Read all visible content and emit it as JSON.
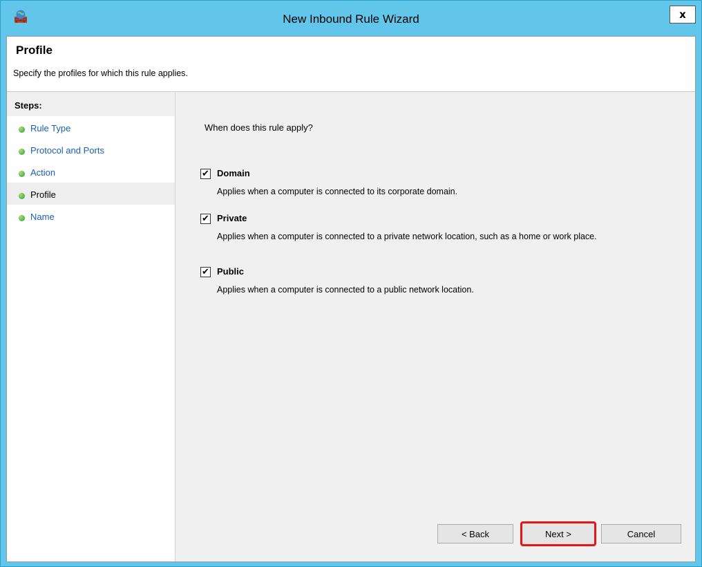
{
  "window": {
    "title": "New Inbound Rule Wizard",
    "close_label": "x"
  },
  "header": {
    "title": "Profile",
    "subtitle": "Specify the profiles for which this rule applies."
  },
  "steps": {
    "heading": "Steps:",
    "items": [
      {
        "label": "Rule Type"
      },
      {
        "label": "Protocol and Ports"
      },
      {
        "label": "Action"
      },
      {
        "label": "Profile"
      },
      {
        "label": "Name"
      }
    ],
    "current_index": 3
  },
  "main": {
    "question": "When does this rule apply?",
    "options": [
      {
        "label": "Domain",
        "checked": true,
        "description": "Applies when a computer is connected to its corporate domain."
      },
      {
        "label": "Private",
        "checked": true,
        "description": "Applies when a computer is connected to a private network location, such as a home or work place."
      },
      {
        "label": "Public",
        "checked": true,
        "description": "Applies when a computer is connected to a public network location."
      }
    ]
  },
  "buttons": {
    "back": "< Back",
    "next": "Next >",
    "cancel": "Cancel"
  },
  "colors": {
    "title_bar": "#62c6ea",
    "link": "#1a5fb4",
    "highlight": "#e81313",
    "step_dot": "#3a9a22"
  }
}
